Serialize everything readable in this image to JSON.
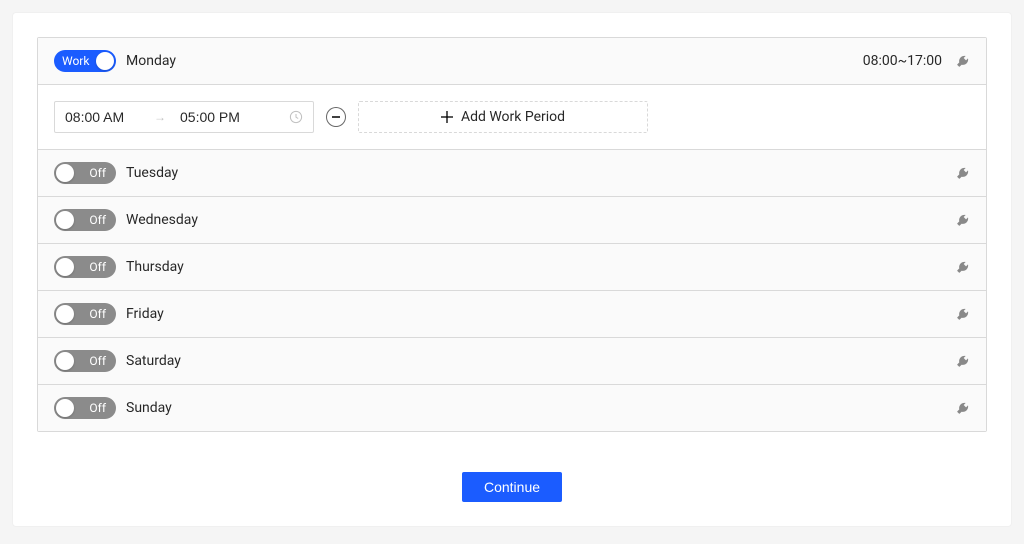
{
  "switch_labels": {
    "on": "Work",
    "off": "Off"
  },
  "add_button": "Add Work Period",
  "footer_button": "Continue",
  "days": [
    {
      "name": "Monday",
      "on": true,
      "expanded": true,
      "summary": "08:00~17:00",
      "periods": [
        {
          "start": "08:00 AM",
          "end": "05:00 PM"
        }
      ]
    },
    {
      "name": "Tuesday",
      "on": false,
      "expanded": false
    },
    {
      "name": "Wednesday",
      "on": false,
      "expanded": false
    },
    {
      "name": "Thursday",
      "on": false,
      "expanded": false
    },
    {
      "name": "Friday",
      "on": false,
      "expanded": false
    },
    {
      "name": "Saturday",
      "on": false,
      "expanded": false
    },
    {
      "name": "Sunday",
      "on": false,
      "expanded": false
    }
  ]
}
